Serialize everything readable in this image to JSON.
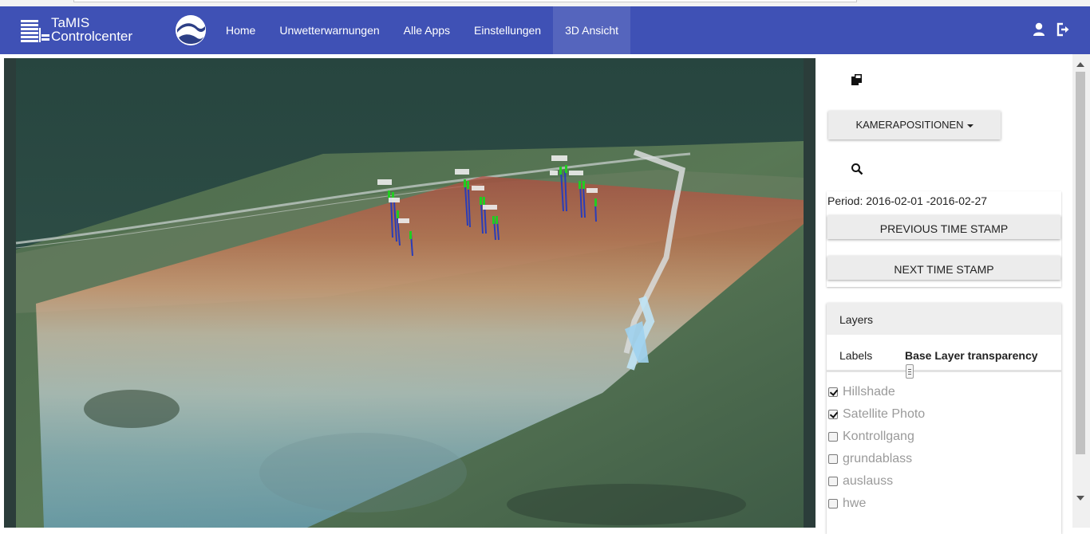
{
  "brand": {
    "line1": "TaMIS",
    "line2": "Controlcenter"
  },
  "nav": {
    "items": [
      {
        "label": "Home"
      },
      {
        "label": "Unwetterwarnungen"
      },
      {
        "label": "Alle Apps"
      },
      {
        "label": "Einstellungen"
      },
      {
        "label": "3D Ansicht"
      }
    ],
    "active_index": 4
  },
  "icons": {
    "user": "user-icon",
    "logout": "logout-icon",
    "copy": "copy-icon",
    "search": "search-icon"
  },
  "sidebar": {
    "camera_button": "KAMERAPOSITIONEN",
    "period_text": "Period: 2016-02-01 -2016-02-27",
    "previous_button": "PREVIOUS TIME STAMP",
    "next_button": "NEXT TIME STAMP",
    "layers": {
      "title": "Layers",
      "tab_labels": "Labels",
      "tab_base": "Base Layer transparency",
      "transparency": 0.35,
      "items": [
        {
          "label": "Hillshade",
          "checked": true
        },
        {
          "label": "Satellite Photo",
          "checked": true
        },
        {
          "label": "Kontrollgang",
          "checked": false
        },
        {
          "label": "grundablass",
          "checked": false
        },
        {
          "label": "auslauss",
          "checked": false
        },
        {
          "label": "hwe",
          "checked": false
        }
      ]
    }
  },
  "colors": {
    "navbar": "#3f51b5",
    "nav_active": "#5565bd",
    "sensor_green": "#22cc22",
    "sensor_blue": "#2a3db8"
  }
}
